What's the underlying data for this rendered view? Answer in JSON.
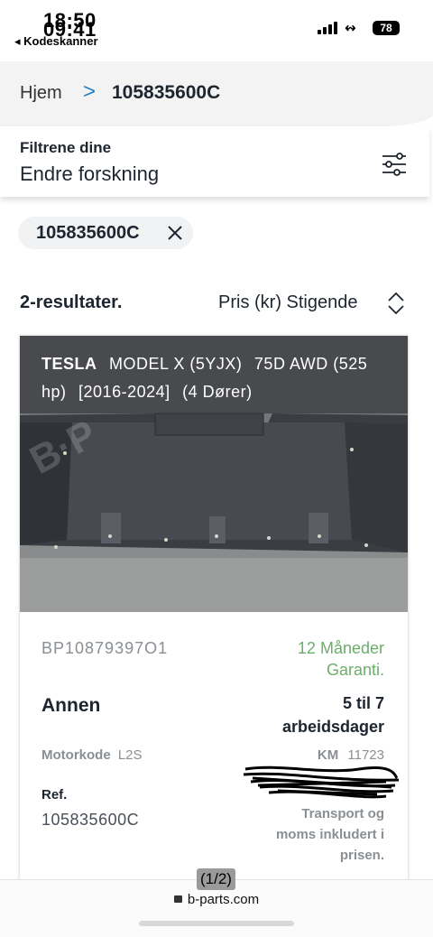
{
  "status_bar": {
    "time_front": "18:50",
    "time_back": "09:41",
    "back_app": "◂ Kodeskanner",
    "wifi": "↭",
    "battery": "78"
  },
  "breadcrumb": {
    "home": "Hjem",
    "separator": ">",
    "current": "105835600C"
  },
  "filters": {
    "title": "Filtrene dine",
    "subtitle": "Endre forskning",
    "icon": "sliders-icon"
  },
  "chip": {
    "label": "105835600C",
    "icon": "close-icon"
  },
  "results": {
    "count": "2-resultater.",
    "sort_label": "Pris (kr) Stigende",
    "sort_icon": "sort-updown-icon"
  },
  "card": {
    "brand": "TESLA",
    "model": "MODEL X (5YJX)",
    "variant": "75D AWD (525",
    "power": "hp)",
    "years": "[2016-2024]",
    "doors": "(4 Dører)",
    "ref_code": "BP10879397O1",
    "warranty": "12 Måneder Garanti.",
    "part_name": "Annen",
    "delivery": "5 til 7 arbeidsdager",
    "engine_label": "Motorkode",
    "engine_value": "L2S",
    "km_label": "KM",
    "km_value": "11723",
    "ref_label": "Ref.",
    "ref_value": "105835600C",
    "price_note": "Transport og moms inkludert i prisen."
  },
  "browser": {
    "page_counter": "(1/2)",
    "url": "b-parts.com"
  },
  "colors": {
    "accent_link": "#2b7fb8",
    "warranty_green": "#6cae6a",
    "text_dark": "#1d2530",
    "text_muted": "#8a8f94"
  }
}
